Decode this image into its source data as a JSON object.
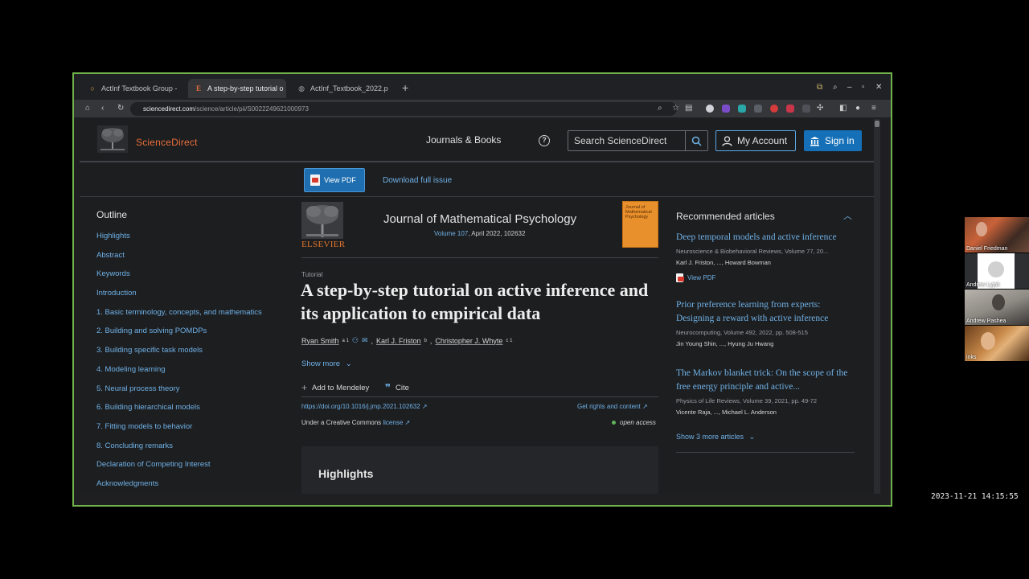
{
  "browser": {
    "tabs": [
      {
        "label": "ActInf Textbook Group -"
      },
      {
        "label": "A step-by-step tutorial o"
      },
      {
        "label": "ActInf_Textbook_2022.p"
      }
    ],
    "url_host": "sciencedirect.com",
    "url_path": "/science/article/pii/S0022249621000973"
  },
  "header": {
    "logo_text": "ScienceDirect",
    "journals_books": "Journals & Books",
    "search_placeholder": "Search ScienceDirect",
    "my_account": "My Account",
    "sign_in": "Sign in"
  },
  "subbar": {
    "view_pdf": "View PDF",
    "download_issue": "Download full issue"
  },
  "outline": {
    "title": "Outline",
    "items": [
      "Highlights",
      "Abstract",
      "Keywords",
      "Introduction",
      "1. Basic terminology, concepts, and mathematics",
      "2. Building and solving POMDPs",
      "3. Building specific task models",
      "4. Modeling learning",
      "5. Neural process theory",
      "6. Building hierarchical models",
      "7. Fitting models to behavior",
      "8. Concluding remarks",
      "Declaration of Competing Interest",
      "Acknowledgments"
    ]
  },
  "journal": {
    "publisher": "ELSEVIER",
    "title": "Journal of Mathematical Psychology",
    "volume": "Volume 107",
    "issue_info": ", April 2022, 102632",
    "cover_title": "Journal of Mathematical Psychology"
  },
  "article": {
    "type": "Tutorial",
    "title": "A step-by-step tutorial on active inference and its application to empirical data",
    "authors": [
      {
        "name": "Ryan Smith",
        "sup": "a 1"
      },
      {
        "name": "Karl J. Friston",
        "sup": "b"
      },
      {
        "name": "Christopher J. Whyte",
        "sup": "c 1"
      }
    ],
    "show_more": "Show more",
    "add_mendeley": "Add to Mendeley",
    "cite": "Cite",
    "doi": "https://doi.org/10.1016/j.jmp.2021.102632",
    "rights": "Get rights and content",
    "license_prefix": "Under a Creative Commons ",
    "license_link": "license",
    "open_access": "open access",
    "highlights_heading": "Highlights"
  },
  "recommended": {
    "title": "Recommended articles",
    "items": [
      {
        "title": "Deep temporal models and active inference",
        "source": "Neuroscience & Biobehavioral Reviews, Volume 77, 20...",
        "authors": "Karl J. Friston, ..., Howard Bowman",
        "pdf": "View PDF"
      },
      {
        "title": "Prior preference learning from experts: Designing a reward with active inference",
        "source": "Neurocomputing, Volume 492, 2022, pp. 508-515",
        "authors": "Jin Young Shin, ..., Hyung Ju Hwang"
      },
      {
        "title": "The Markov blanket trick: On the scope of the free energy principle and active...",
        "source": "Physics of Life Reviews, Volume 39, 2021, pp. 49-72",
        "authors": "Vicente Raja, ..., Michael L. Anderson"
      }
    ],
    "show_more": "Show 3 more articles"
  },
  "participants": [
    "Daniel Friedman",
    "Andrew Lyjak",
    "Andrew Pashea",
    "inks"
  ],
  "timestamp": "2023-11-21 14:15:55",
  "colors": {
    "frame_border": "#6fb24a",
    "link": "#6fb1e6",
    "brand_orange": "#e96f3a",
    "primary_button": "#1570b8"
  }
}
